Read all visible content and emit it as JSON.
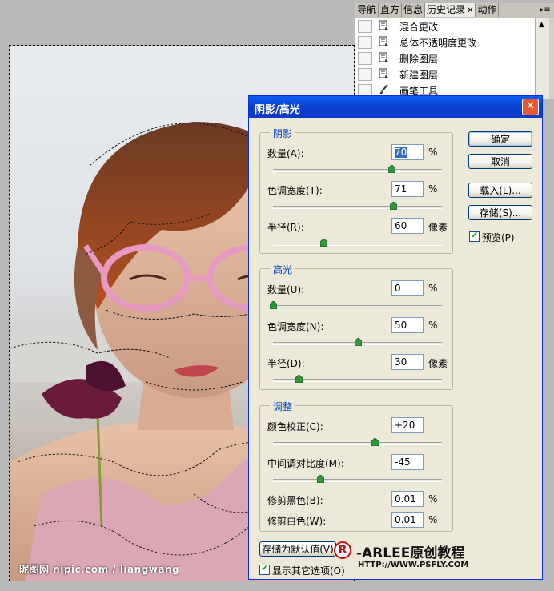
{
  "history_panel": {
    "tabs": [
      "导航",
      "直方",
      "信息",
      "历史记录",
      "动作"
    ],
    "active_tab": "历史记录",
    "items": [
      {
        "label": "混合更改",
        "icon": "history-state-icon"
      },
      {
        "label": "总体不透明度更改",
        "icon": "history-state-icon"
      },
      {
        "label": "删除图层",
        "icon": "history-state-icon"
      },
      {
        "label": "新建图层",
        "icon": "history-state-icon"
      },
      {
        "label": "画笔工具",
        "icon": "brush-icon"
      }
    ]
  },
  "canvas": {
    "watermark": "昵图网 nipic.com / liangwang"
  },
  "dialog": {
    "title": "阴影/高光",
    "shadows": {
      "title": "阴影",
      "amount_label": "数量(A):",
      "amount_value": "70",
      "amount_unit": "%",
      "amount_level": 70,
      "tonal_label": "色调宽度(T):",
      "tonal_value": "71",
      "tonal_unit": "%",
      "tonal_level": 71,
      "radius_label": "半径(R):",
      "radius_value": "60",
      "radius_unit": "像素",
      "radius_level": 30
    },
    "highlights": {
      "title": "高光",
      "amount_label": "数量(U):",
      "amount_value": "0",
      "amount_unit": "%",
      "amount_level": 0,
      "tonal_label": "色调宽度(N):",
      "tonal_value": "50",
      "tonal_unit": "%",
      "tonal_level": 50,
      "radius_label": "半径(D):",
      "radius_value": "30",
      "radius_unit": "像素",
      "radius_level": 15
    },
    "adjustments": {
      "title": "调整",
      "color_label": "颜色校正(C):",
      "color_value": "+20",
      "color_level": 60,
      "midtone_label": "中间调对比度(M):",
      "midtone_value": "-45",
      "midtone_level": 28,
      "black_label": "修剪黑色(B):",
      "black_value": "0.01",
      "black_unit": "%",
      "white_label": "修剪白色(W):",
      "white_value": "0.01",
      "white_unit": "%"
    },
    "buttons": {
      "ok": "确定",
      "cancel": "取消",
      "load": "载入(L)...",
      "save": "存储(S)..."
    },
    "preview_label": "预览(P)",
    "preview_checked": true,
    "save_default_label": "存储为默认值(V)",
    "show_more_label": "显示其它选项(O)",
    "show_more_checked": true,
    "brand_logo": "R",
    "brand_name": "-ARLEE原创教程",
    "brand_url": "HTTP://WWW.PSFLY.COM"
  }
}
